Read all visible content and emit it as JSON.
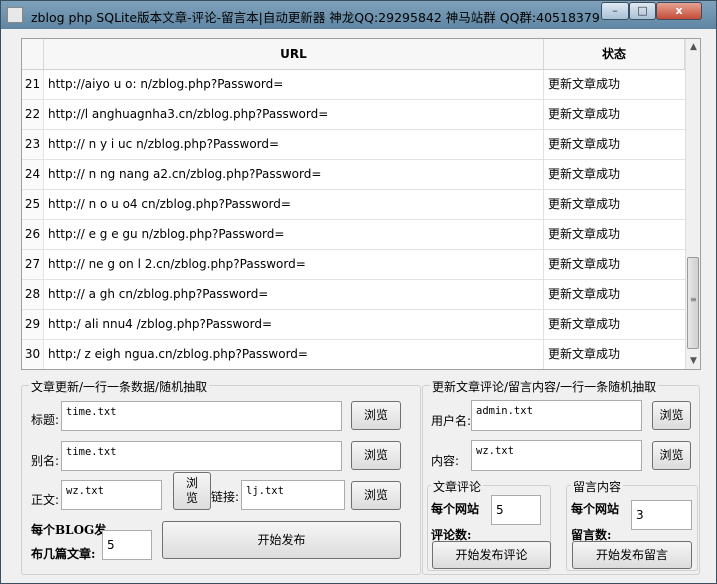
{
  "window": {
    "title": "zblog php SQLite版本文章-评论-留言本|自动更新器 神龙QQ:29295842 神马站群 QQ群:40518379",
    "controls": [
      "–",
      "□",
      "x"
    ]
  },
  "grid": {
    "headers": {
      "url": "URL",
      "status": "状态"
    },
    "rows": [
      {
        "n": "21",
        "url": "http://aiyo u o: n/zblog.php?Password=",
        "status": "更新文章成功"
      },
      {
        "n": "22",
        "url": "http://l anghuagnha3.cn/zblog.php?Password=",
        "status": "更新文章成功"
      },
      {
        "n": "23",
        "url": "http:// n y i uc n/zblog.php?Password=",
        "status": "更新文章成功"
      },
      {
        "n": "24",
        "url": "http:// n ng nang a2.cn/zblog.php?Password=",
        "status": "更新文章成功"
      },
      {
        "n": "25",
        "url": "http:// n o u o4 cn/zblog.php?Password=",
        "status": "更新文章成功"
      },
      {
        "n": "26",
        "url": "http:// e g e gu n/zblog.php?Password=",
        "status": "更新文章成功"
      },
      {
        "n": "27",
        "url": "http:// ne g on l 2.cn/zblog.php?Password=",
        "status": "更新文章成功"
      },
      {
        "n": "28",
        "url": "http:// a gh cn/zblog.php?Password=",
        "status": "更新文章成功"
      },
      {
        "n": "29",
        "url": "http:/ ali nnu4 /zblog.php?Password=",
        "status": "更新文章成功"
      },
      {
        "n": "30",
        "url": "http:/ z eigh ngua.cn/zblog.php?Password=",
        "status": "更新文章成功"
      }
    ]
  },
  "article": {
    "group_label": "文章更新/一行一条数据/随机抽取",
    "title_label": "标题:",
    "title_value": "time.txt",
    "alias_label": "别名:",
    "alias_value": "time.txt",
    "body_label": "正文:",
    "body_value": "wz.txt",
    "link_label": "链接:",
    "link_value": "lj.txt",
    "browse": "浏览",
    "browse_split_1": "浏",
    "browse_split_2": "览",
    "per_blog_1": "每个BLOG发",
    "per_blog_2": "布几篇文章:",
    "per_blog_value": "5",
    "publish": "开始发布"
  },
  "comment": {
    "group_label": "更新文章评论/留言内容/一行一条随机抽取",
    "user_label": "用户名:",
    "user_value": "admin.txt",
    "content_label": "内容:",
    "content_value": "wz.txt",
    "browse": "浏览",
    "sub1_label": "文章评论",
    "sub1_line1": "每个网站",
    "sub1_line2": "评论数:",
    "sub1_value": "5",
    "sub1_button": "开始发布评论",
    "sub2_label": "留言内容",
    "sub2_line1": "每个网站",
    "sub2_line2": "留言数:",
    "sub2_value": "3",
    "sub2_button": "开始发布留言"
  },
  "colors": {
    "titlebar": "#6a8eab",
    "close": "#c44b36"
  }
}
